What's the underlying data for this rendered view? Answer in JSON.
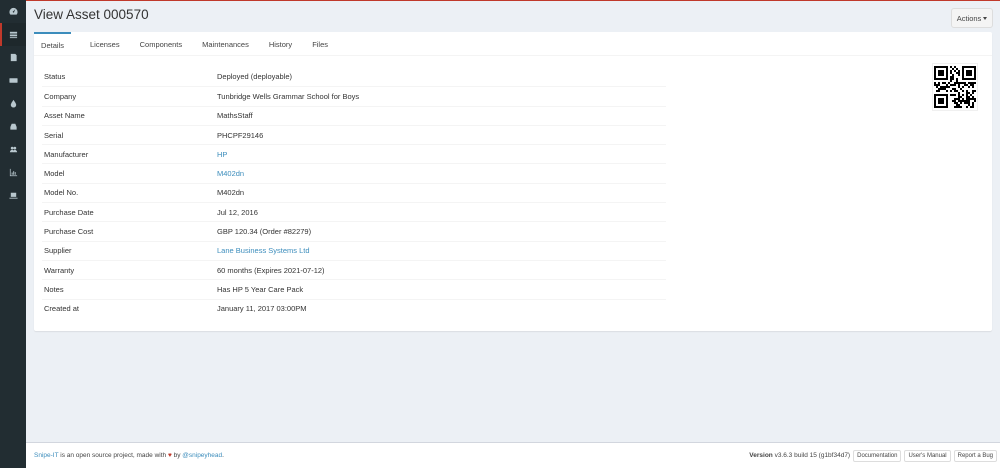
{
  "page": {
    "title": "View Asset 000570",
    "actions_label": "Actions"
  },
  "sidebar": {
    "items": [
      {
        "icon": "dashboard-icon"
      },
      {
        "icon": "assets-icon",
        "active": true
      },
      {
        "icon": "licenses-icon"
      },
      {
        "icon": "accessories-icon"
      },
      {
        "icon": "consumables-icon"
      },
      {
        "icon": "components-icon"
      },
      {
        "icon": "people-icon"
      },
      {
        "icon": "reports-icon"
      },
      {
        "icon": "laptop-icon"
      }
    ]
  },
  "tabs": [
    {
      "label": "Details",
      "active": true
    },
    {
      "label": "Licenses"
    },
    {
      "label": "Components"
    },
    {
      "label": "Maintenances"
    },
    {
      "label": "History"
    },
    {
      "label": "Files"
    }
  ],
  "details": [
    {
      "label": "Status",
      "value": "Deployed (deployable)",
      "link": false
    },
    {
      "label": "Company",
      "value": "Tunbridge Wells Grammar School for Boys",
      "link": false
    },
    {
      "label": "Asset Name",
      "value": "MathsStaff",
      "link": false
    },
    {
      "label": "Serial",
      "value": "PHCPF29146",
      "link": false
    },
    {
      "label": "Manufacturer",
      "value": "HP",
      "link": true
    },
    {
      "label": "Model",
      "value": "M402dn",
      "link": true
    },
    {
      "label": "Model No.",
      "value": "M402dn",
      "link": false
    },
    {
      "label": "Purchase Date",
      "value": "Jul 12, 2016",
      "link": false
    },
    {
      "label": "Purchase Cost",
      "value": "GBP 120.34 (Order #82279)",
      "link": false
    },
    {
      "label": "Supplier",
      "value": "Lane Business Systems Ltd",
      "link": true
    },
    {
      "label": "Warranty",
      "value": "60 months (Expires 2021-07-12)",
      "link": false
    },
    {
      "label": "Notes",
      "value": "Has HP 5 Year Care Pack",
      "link": false
    },
    {
      "label": "Created at",
      "value": "January 11, 2017 03:00PM",
      "link": false
    }
  ],
  "footer": {
    "brand": "Snipe-IT",
    "text_mid": " is an open source project, made with ",
    "text_by": " by ",
    "author": "@snipeyhead",
    "author_end": ".",
    "version_label": "Version",
    "version_value": " v3.6.3 build 15 (g1bf34d7)",
    "documentation": "Documentation",
    "users_manual": "User's Manual",
    "report_bug": "Report a Bug"
  },
  "colors": {
    "accent": "#3c8dbc",
    "sidebar_bg": "#222d32",
    "active_marker": "#c0392b"
  }
}
